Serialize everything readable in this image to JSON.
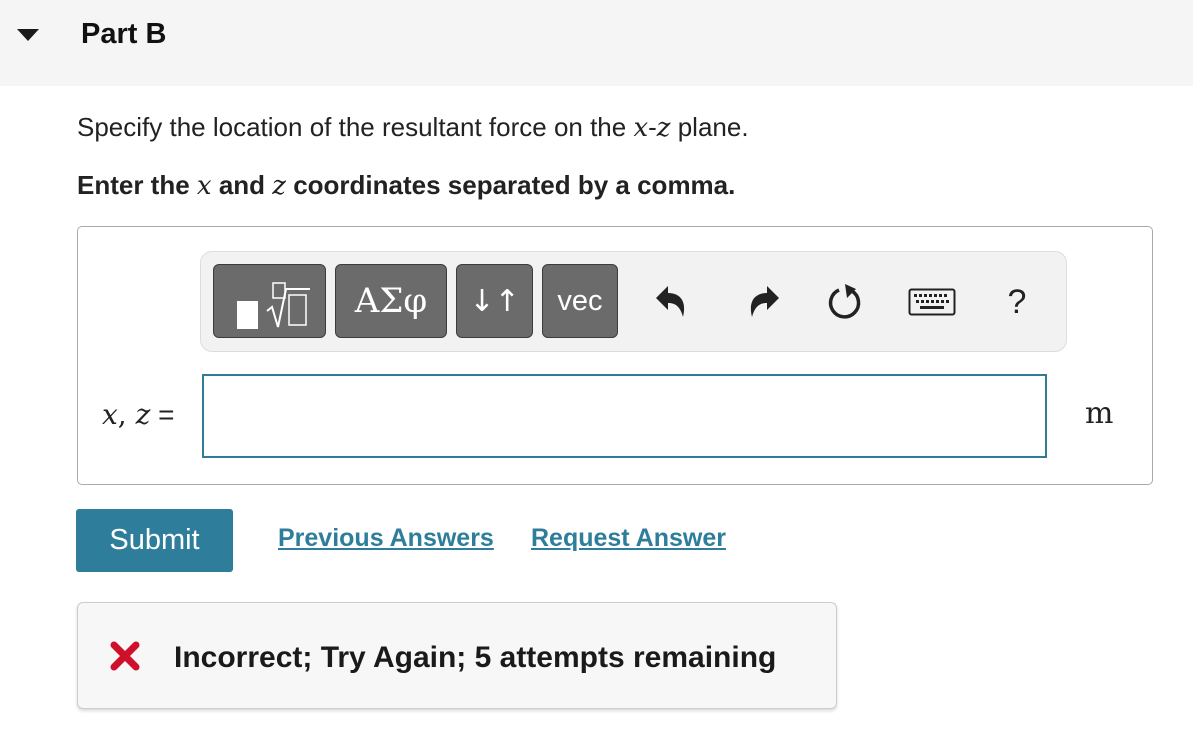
{
  "part": {
    "title": "Part B"
  },
  "question": {
    "text_before": "Specify the location of the resultant force on the ",
    "var_x": "x",
    "dash": "-",
    "var_z": "z",
    "text_after": " plane.",
    "instruction_1": "Enter the ",
    "instruction_and": " and ",
    "instruction_2": " coordinates separated by a comma."
  },
  "toolbar": {
    "greek_label": "ΑΣφ",
    "arrows_label": "↓↑",
    "vec_label": "vec",
    "help_label": "?"
  },
  "answer": {
    "label_x": "x",
    "label_comma": ", ",
    "label_z": "z",
    "label_eq": " =",
    "value": "",
    "placeholder": "",
    "unit": "m"
  },
  "actions": {
    "submit_label": "Submit",
    "previous_answers": "Previous Answers",
    "request_answer": "Request Answer"
  },
  "feedback": {
    "message": "Incorrect; Try Again; 5 attempts remaining",
    "status_color": "#d0102b"
  },
  "colors": {
    "accent": "#2e7d9a"
  }
}
